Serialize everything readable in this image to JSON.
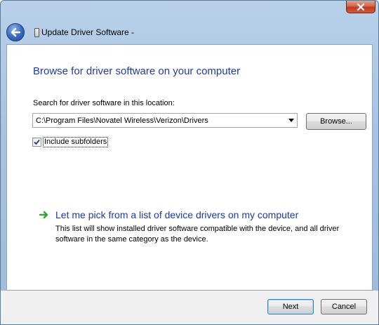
{
  "window": {
    "nav_title": "Update Driver Software -"
  },
  "content": {
    "heading": "Browse for driver software on your computer",
    "search_label": "Search for driver software in this location:",
    "path_value": "C:\\Program Files\\Novatel Wireless\\Verizon\\Drivers",
    "browse_label": "Browse...",
    "include_subfolders_label": "Include subfolders",
    "include_subfolders_checked": true,
    "pick_link": "Let me pick from a list of device drivers on my computer",
    "pick_description": "This list will show installed driver software compatible with the device, and all driver software in the same category as the device."
  },
  "footer": {
    "next_label": "Next",
    "cancel_label": "Cancel"
  },
  "icons": {
    "back": "back-arrow-icon",
    "close": "close-icon",
    "device": "device-icon",
    "dropdown": "chevron-down-icon",
    "check": "checkmark-icon",
    "link_arrow": "green-arrow-icon"
  },
  "colors": {
    "heading": "#1e3ca0",
    "link_arrow": "#2fa62f",
    "close_button": "#c2391c",
    "title_bar": "#b9d1ea"
  }
}
